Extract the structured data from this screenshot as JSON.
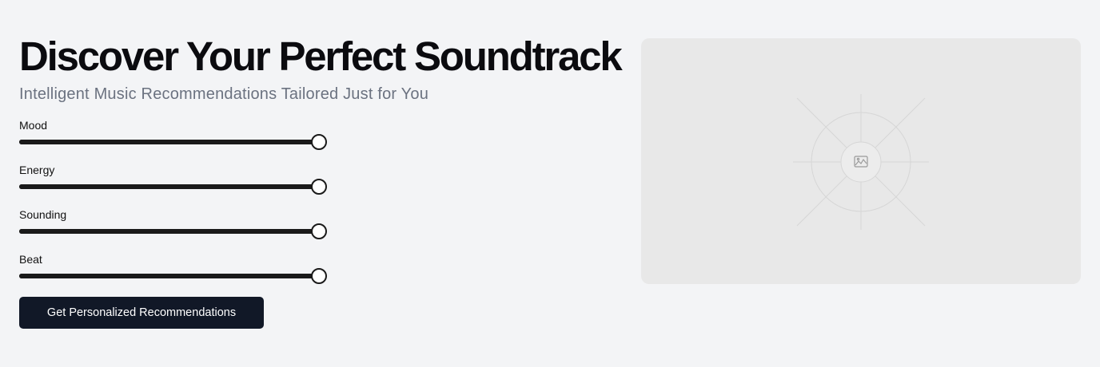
{
  "hero": {
    "title": "Discover Your Perfect Soundtrack",
    "subtitle": "Intelligent Music Recommendations Tailored Just for You"
  },
  "sliders": [
    {
      "label": "Mood",
      "value": 100
    },
    {
      "label": "Energy",
      "value": 100
    },
    {
      "label": "Sounding",
      "value": 100
    },
    {
      "label": "Beat",
      "value": 100
    }
  ],
  "cta": {
    "label": "Get Personalized Recommendations"
  },
  "image_placeholder": {
    "icon": "image-icon"
  },
  "colors": {
    "background": "#f3f4f6",
    "track": "#1a1a1a",
    "button": "#111827",
    "panel": "#e8e8e8",
    "subtitle": "#6b7280"
  }
}
